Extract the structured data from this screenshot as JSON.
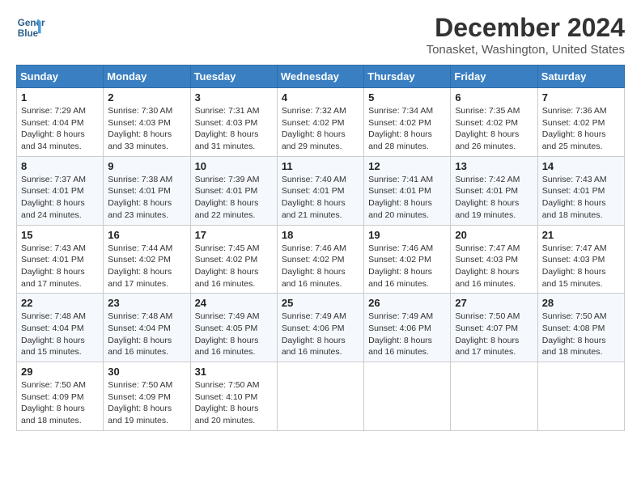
{
  "header": {
    "logo_line1": "General",
    "logo_line2": "Blue",
    "month_title": "December 2024",
    "location": "Tonasket, Washington, United States"
  },
  "days_of_week": [
    "Sunday",
    "Monday",
    "Tuesday",
    "Wednesday",
    "Thursday",
    "Friday",
    "Saturday"
  ],
  "weeks": [
    [
      {
        "day": "1",
        "sunrise": "Sunrise: 7:29 AM",
        "sunset": "Sunset: 4:04 PM",
        "daylight": "Daylight: 8 hours and 34 minutes."
      },
      {
        "day": "2",
        "sunrise": "Sunrise: 7:30 AM",
        "sunset": "Sunset: 4:03 PM",
        "daylight": "Daylight: 8 hours and 33 minutes."
      },
      {
        "day": "3",
        "sunrise": "Sunrise: 7:31 AM",
        "sunset": "Sunset: 4:03 PM",
        "daylight": "Daylight: 8 hours and 31 minutes."
      },
      {
        "day": "4",
        "sunrise": "Sunrise: 7:32 AM",
        "sunset": "Sunset: 4:02 PM",
        "daylight": "Daylight: 8 hours and 29 minutes."
      },
      {
        "day": "5",
        "sunrise": "Sunrise: 7:34 AM",
        "sunset": "Sunset: 4:02 PM",
        "daylight": "Daylight: 8 hours and 28 minutes."
      },
      {
        "day": "6",
        "sunrise": "Sunrise: 7:35 AM",
        "sunset": "Sunset: 4:02 PM",
        "daylight": "Daylight: 8 hours and 26 minutes."
      },
      {
        "day": "7",
        "sunrise": "Sunrise: 7:36 AM",
        "sunset": "Sunset: 4:02 PM",
        "daylight": "Daylight: 8 hours and 25 minutes."
      }
    ],
    [
      {
        "day": "8",
        "sunrise": "Sunrise: 7:37 AM",
        "sunset": "Sunset: 4:01 PM",
        "daylight": "Daylight: 8 hours and 24 minutes."
      },
      {
        "day": "9",
        "sunrise": "Sunrise: 7:38 AM",
        "sunset": "Sunset: 4:01 PM",
        "daylight": "Daylight: 8 hours and 23 minutes."
      },
      {
        "day": "10",
        "sunrise": "Sunrise: 7:39 AM",
        "sunset": "Sunset: 4:01 PM",
        "daylight": "Daylight: 8 hours and 22 minutes."
      },
      {
        "day": "11",
        "sunrise": "Sunrise: 7:40 AM",
        "sunset": "Sunset: 4:01 PM",
        "daylight": "Daylight: 8 hours and 21 minutes."
      },
      {
        "day": "12",
        "sunrise": "Sunrise: 7:41 AM",
        "sunset": "Sunset: 4:01 PM",
        "daylight": "Daylight: 8 hours and 20 minutes."
      },
      {
        "day": "13",
        "sunrise": "Sunrise: 7:42 AM",
        "sunset": "Sunset: 4:01 PM",
        "daylight": "Daylight: 8 hours and 19 minutes."
      },
      {
        "day": "14",
        "sunrise": "Sunrise: 7:43 AM",
        "sunset": "Sunset: 4:01 PM",
        "daylight": "Daylight: 8 hours and 18 minutes."
      }
    ],
    [
      {
        "day": "15",
        "sunrise": "Sunrise: 7:43 AM",
        "sunset": "Sunset: 4:01 PM",
        "daylight": "Daylight: 8 hours and 17 minutes."
      },
      {
        "day": "16",
        "sunrise": "Sunrise: 7:44 AM",
        "sunset": "Sunset: 4:02 PM",
        "daylight": "Daylight: 8 hours and 17 minutes."
      },
      {
        "day": "17",
        "sunrise": "Sunrise: 7:45 AM",
        "sunset": "Sunset: 4:02 PM",
        "daylight": "Daylight: 8 hours and 16 minutes."
      },
      {
        "day": "18",
        "sunrise": "Sunrise: 7:46 AM",
        "sunset": "Sunset: 4:02 PM",
        "daylight": "Daylight: 8 hours and 16 minutes."
      },
      {
        "day": "19",
        "sunrise": "Sunrise: 7:46 AM",
        "sunset": "Sunset: 4:02 PM",
        "daylight": "Daylight: 8 hours and 16 minutes."
      },
      {
        "day": "20",
        "sunrise": "Sunrise: 7:47 AM",
        "sunset": "Sunset: 4:03 PM",
        "daylight": "Daylight: 8 hours and 16 minutes."
      },
      {
        "day": "21",
        "sunrise": "Sunrise: 7:47 AM",
        "sunset": "Sunset: 4:03 PM",
        "daylight": "Daylight: 8 hours and 15 minutes."
      }
    ],
    [
      {
        "day": "22",
        "sunrise": "Sunrise: 7:48 AM",
        "sunset": "Sunset: 4:04 PM",
        "daylight": "Daylight: 8 hours and 15 minutes."
      },
      {
        "day": "23",
        "sunrise": "Sunrise: 7:48 AM",
        "sunset": "Sunset: 4:04 PM",
        "daylight": "Daylight: 8 hours and 16 minutes."
      },
      {
        "day": "24",
        "sunrise": "Sunrise: 7:49 AM",
        "sunset": "Sunset: 4:05 PM",
        "daylight": "Daylight: 8 hours and 16 minutes."
      },
      {
        "day": "25",
        "sunrise": "Sunrise: 7:49 AM",
        "sunset": "Sunset: 4:06 PM",
        "daylight": "Daylight: 8 hours and 16 minutes."
      },
      {
        "day": "26",
        "sunrise": "Sunrise: 7:49 AM",
        "sunset": "Sunset: 4:06 PM",
        "daylight": "Daylight: 8 hours and 16 minutes."
      },
      {
        "day": "27",
        "sunrise": "Sunrise: 7:50 AM",
        "sunset": "Sunset: 4:07 PM",
        "daylight": "Daylight: 8 hours and 17 minutes."
      },
      {
        "day": "28",
        "sunrise": "Sunrise: 7:50 AM",
        "sunset": "Sunset: 4:08 PM",
        "daylight": "Daylight: 8 hours and 18 minutes."
      }
    ],
    [
      {
        "day": "29",
        "sunrise": "Sunrise: 7:50 AM",
        "sunset": "Sunset: 4:09 PM",
        "daylight": "Daylight: 8 hours and 18 minutes."
      },
      {
        "day": "30",
        "sunrise": "Sunrise: 7:50 AM",
        "sunset": "Sunset: 4:09 PM",
        "daylight": "Daylight: 8 hours and 19 minutes."
      },
      {
        "day": "31",
        "sunrise": "Sunrise: 7:50 AM",
        "sunset": "Sunset: 4:10 PM",
        "daylight": "Daylight: 8 hours and 20 minutes."
      },
      null,
      null,
      null,
      null
    ]
  ]
}
